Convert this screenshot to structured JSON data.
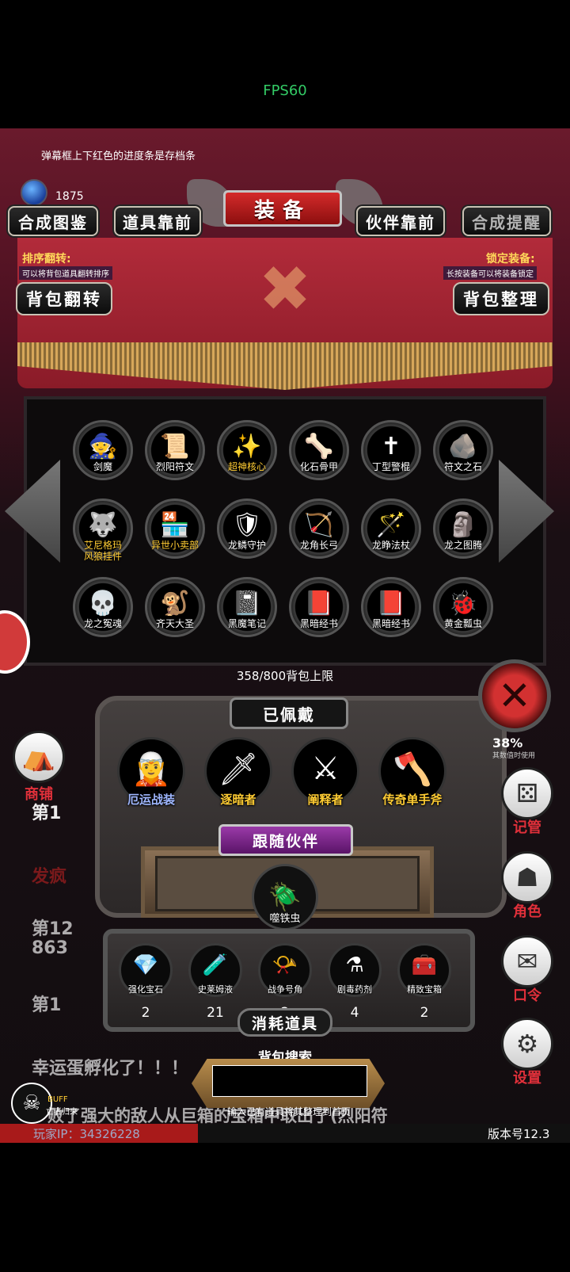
{
  "status": {
    "fps": "FPS60"
  },
  "tip": "弹幕框上下红色的进度条是存档条",
  "currency": {
    "count": "1875"
  },
  "header": {
    "title": "装备",
    "buttons": [
      "合成图鉴",
      "道具靠前",
      "伙伴靠前",
      "合成提醒"
    ]
  },
  "sort": {
    "flip_label": "排序翻转:",
    "flip_note": "可以将背包道具翻转排序",
    "lock_label": "锁定装备:",
    "lock_note": "长按装备可以将装备锁定",
    "flip_button": "背包翻转",
    "tidy_button": "背包整理"
  },
  "inventory": {
    "items": [
      {
        "name": "剑魔",
        "icon": "demon-knight"
      },
      {
        "name": "烈阳符文",
        "icon": "sun-rune"
      },
      {
        "name": "超神核心",
        "icon": "divine-core",
        "highlight": true
      },
      {
        "name": "化石骨甲",
        "icon": "bone-armor"
      },
      {
        "name": "丁型警棍",
        "icon": "baton"
      },
      {
        "name": "符文之石",
        "icon": "rune-stone"
      },
      {
        "name": "艾尼格玛\n风狼挂件",
        "icon": "wolf-pendant",
        "highlight": true
      },
      {
        "name": "异世小卖部",
        "icon": "shop-booth",
        "highlight": true
      },
      {
        "name": "龙鳞守护",
        "icon": "dragon-shield"
      },
      {
        "name": "龙角长弓",
        "icon": "dragon-bow"
      },
      {
        "name": "龙睁法杖",
        "icon": "dragon-staff"
      },
      {
        "name": "龙之图腾",
        "icon": "dragon-totem"
      },
      {
        "name": "龙之冤魂",
        "icon": "dragon-spirit"
      },
      {
        "name": "齐天大圣",
        "icon": "monkey-king"
      },
      {
        "name": "黑魔笔记",
        "icon": "dark-notebook"
      },
      {
        "name": "黑暗经书",
        "icon": "dark-scripture"
      },
      {
        "name": "黑暗经书",
        "icon": "dark-scripture"
      },
      {
        "name": "黄金瓢虫",
        "icon": "golden-ladybug"
      }
    ],
    "capacity": "358/800背包上限"
  },
  "equipped": {
    "title": "已佩戴",
    "slots": [
      {
        "name": "厄运战装",
        "icon": "doom-armor"
      },
      {
        "name": "逐暗者",
        "icon": "light-sword"
      },
      {
        "name": "阐释者",
        "icon": "dark-sword"
      },
      {
        "name": "传奇单手斧",
        "icon": "legend-axe"
      }
    ]
  },
  "partner": {
    "title": "跟随伙伴",
    "name": "噬铁虫",
    "icon": "iron-beetle"
  },
  "consumables": {
    "title": "消耗道具",
    "items": [
      {
        "name": "强化宝石",
        "count": "2",
        "icon": "green-gem"
      },
      {
        "name": "史莱姆液",
        "count": "21",
        "icon": "slime-potion"
      },
      {
        "name": "战争号角",
        "count": "2",
        "icon": "war-horn"
      },
      {
        "name": "剧毒药剂",
        "count": "4",
        "icon": "poison-flask"
      },
      {
        "name": "精致宝箱",
        "count": "2",
        "icon": "chest"
      }
    ]
  },
  "search": {
    "title": "背包搜索",
    "value": "",
    "hint": "输入已有道具将其整理到首页"
  },
  "background_log": {
    "l1": "第1",
    "l2": "发疯",
    "l3": "第12",
    "l4": "863",
    "l5": "第1",
    "l6": "幸运蛋孵化了！！！",
    "l7": "败了强大的敌人从巨箱的宝箱中取出了(烈阳符"
  },
  "side_menu": {
    "shop": "商铺",
    "manage": "记管",
    "role": "角色",
    "code": "口令",
    "settings": "设置"
  },
  "stat": {
    "percent": "38%",
    "note": "其数值时使用"
  },
  "buff": {
    "label": "BUFF",
    "sub": "亡者归来"
  },
  "footer": {
    "player_ip": "玩家IP：34326228",
    "version": "版本号12.3"
  }
}
